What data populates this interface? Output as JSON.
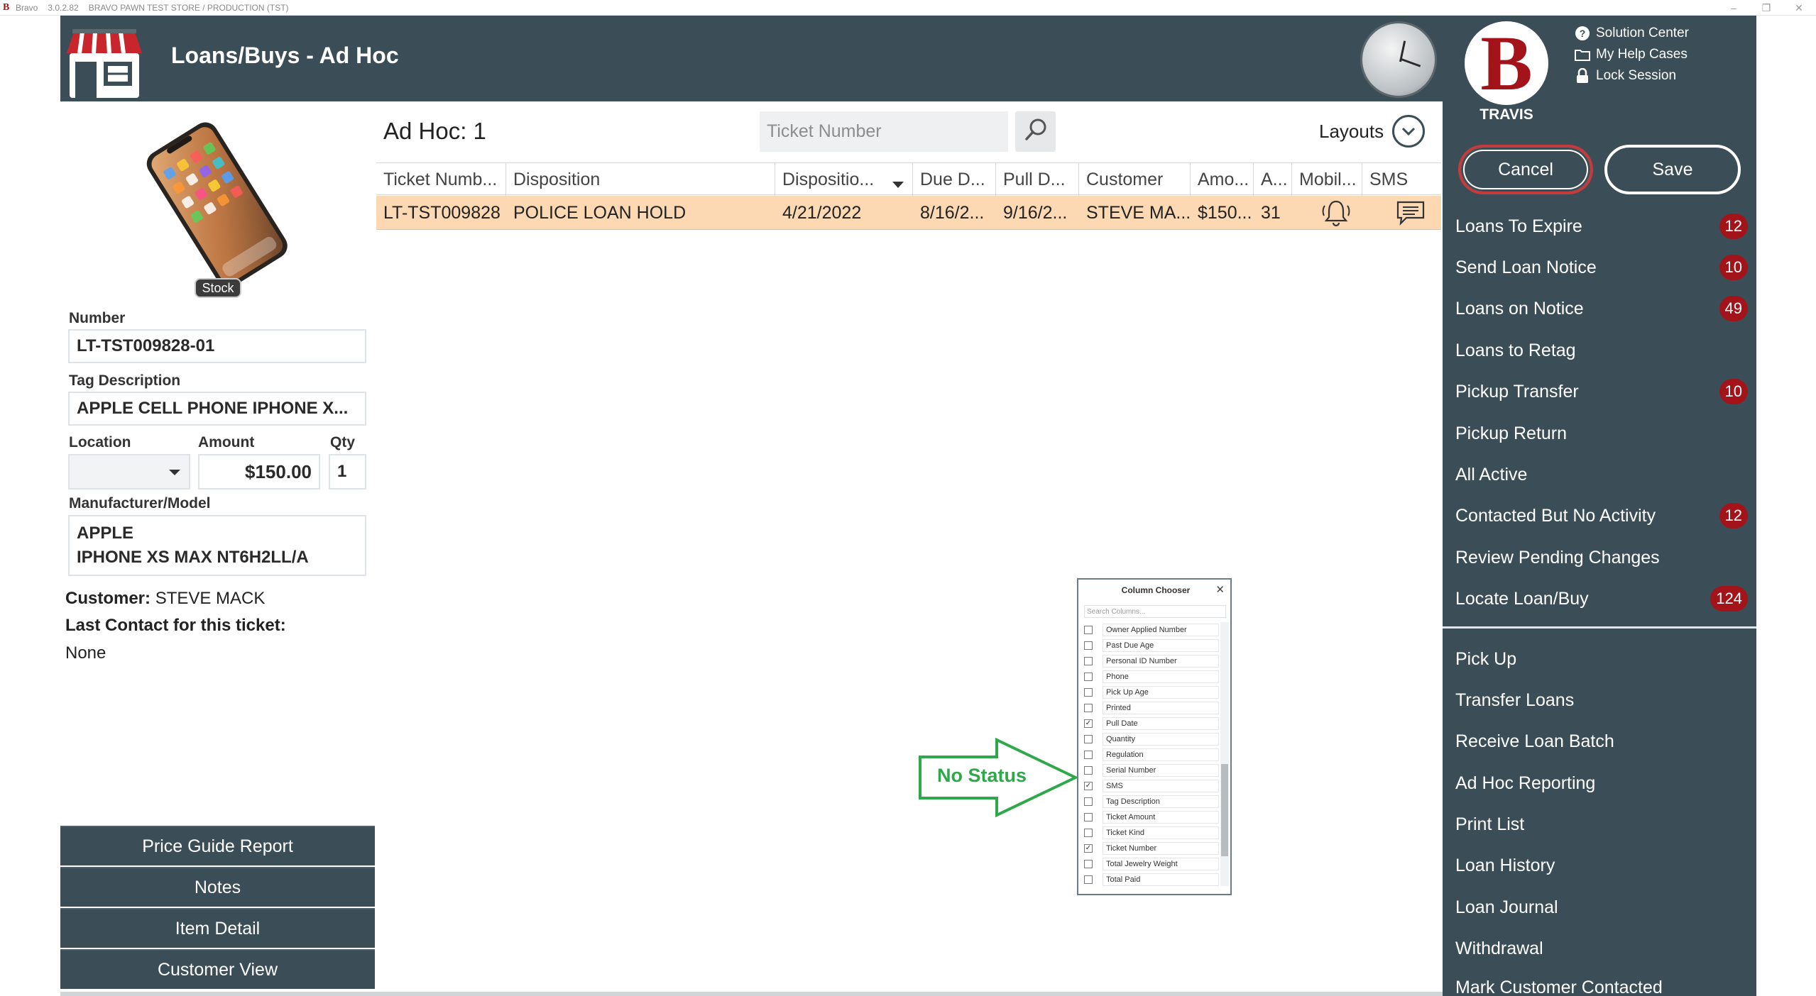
{
  "window": {
    "app_name": "Bravo",
    "version": "3.0.2.82",
    "store": "BRAVO PAWN TEST STORE / PRODUCTION (TST)"
  },
  "header": {
    "title": "Loans/Buys - Ad Hoc"
  },
  "user": {
    "name": "TRAVIS",
    "help_links": [
      "Solution Center",
      "My Help Cases",
      "Lock Session"
    ]
  },
  "actions": {
    "cancel": "Cancel",
    "save": "Save"
  },
  "menu_top": [
    {
      "label": "Loans To Expire",
      "badge": "12"
    },
    {
      "label": "Send Loan Notice",
      "badge": "10"
    },
    {
      "label": "Loans on Notice",
      "badge": "49"
    },
    {
      "label": "Loans to Retag",
      "badge": ""
    },
    {
      "label": "Pickup Transfer",
      "badge": "10"
    },
    {
      "label": "Pickup Return",
      "badge": ""
    },
    {
      "label": "All Active",
      "badge": ""
    },
    {
      "label": "Contacted But No Activity",
      "badge": "12"
    },
    {
      "label": "Review Pending Changes",
      "badge": ""
    },
    {
      "label": "Locate Loan/Buy",
      "badge": "124"
    }
  ],
  "menu_bottom": [
    "Pick Up",
    "Transfer Loans",
    "Receive Loan Batch",
    "Ad Hoc Reporting",
    "Print List",
    "Loan History",
    "Loan Journal",
    "Withdrawal",
    "Mark Customer Contacted"
  ],
  "item": {
    "stock_label": "Stock",
    "number_label": "Number",
    "number": "LT-TST009828-01",
    "tag_label": "Tag Description",
    "tag": "APPLE CELL PHONE IPHONE X...",
    "location_label": "Location",
    "location": "",
    "amount_label": "Amount",
    "amount": "$150.00",
    "qty_label": "Qty",
    "qty": "1",
    "mfr_label": "Manufacturer/Model",
    "mfr_line1": "APPLE",
    "mfr_line2": "IPHONE XS MAX NT6H2LL/A",
    "customer_label": "Customer:",
    "customer": "STEVE MACK",
    "last_contact_label": "Last Contact for this ticket:",
    "last_contact": "None"
  },
  "left_buttons": [
    "Price Guide Report",
    "Notes",
    "Item Detail",
    "Customer View"
  ],
  "grid": {
    "title": "Ad Hoc: 1",
    "search_placeholder": "Ticket Number",
    "layouts_label": "Layouts",
    "columns": [
      "Ticket Numb...",
      "Disposition",
      "Dispositio...",
      "Due D...",
      "Pull D...",
      "Customer",
      "Amo...",
      "A...",
      "Mobil...",
      "SMS"
    ],
    "rows": [
      {
        "ticket": "LT-TST009828",
        "disposition": "POLICE LOAN HOLD",
        "disposition_date": "4/21/2022",
        "due_date": "8/16/2...",
        "pull_date": "9/16/2...",
        "customer": "STEVE MA...",
        "amount": "$150...",
        "age": "31",
        "mobile_icon": "bell-ringing-icon",
        "sms_icon": "message-icon"
      }
    ]
  },
  "annotation": {
    "text": "No Status",
    "color": "#2ea84a"
  },
  "column_chooser": {
    "title": "Column Chooser",
    "search_placeholder": "Search Columns...",
    "items": [
      {
        "label": "Owner Applied Number",
        "checked": false
      },
      {
        "label": "Past Due Age",
        "checked": false
      },
      {
        "label": "Personal ID Number",
        "checked": false
      },
      {
        "label": "Phone",
        "checked": false
      },
      {
        "label": "Pick Up Age",
        "checked": false
      },
      {
        "label": "Printed",
        "checked": false
      },
      {
        "label": "Pull Date",
        "checked": true
      },
      {
        "label": "Quantity",
        "checked": false
      },
      {
        "label": "Regulation",
        "checked": false
      },
      {
        "label": "Serial Number",
        "checked": false
      },
      {
        "label": "SMS",
        "checked": true
      },
      {
        "label": "Tag Description",
        "checked": false
      },
      {
        "label": "Ticket Amount",
        "checked": false
      },
      {
        "label": "Ticket Kind",
        "checked": false
      },
      {
        "label": "Ticket Number",
        "checked": true
      },
      {
        "label": "Total Jewelry Weight",
        "checked": false
      },
      {
        "label": "Total Paid",
        "checked": false
      }
    ]
  },
  "colors": {
    "header_bg": "#3b4d56",
    "badge": "#a3131a",
    "row_highlight": "#fcd8b3",
    "cancel_border": "#c43b3b"
  }
}
